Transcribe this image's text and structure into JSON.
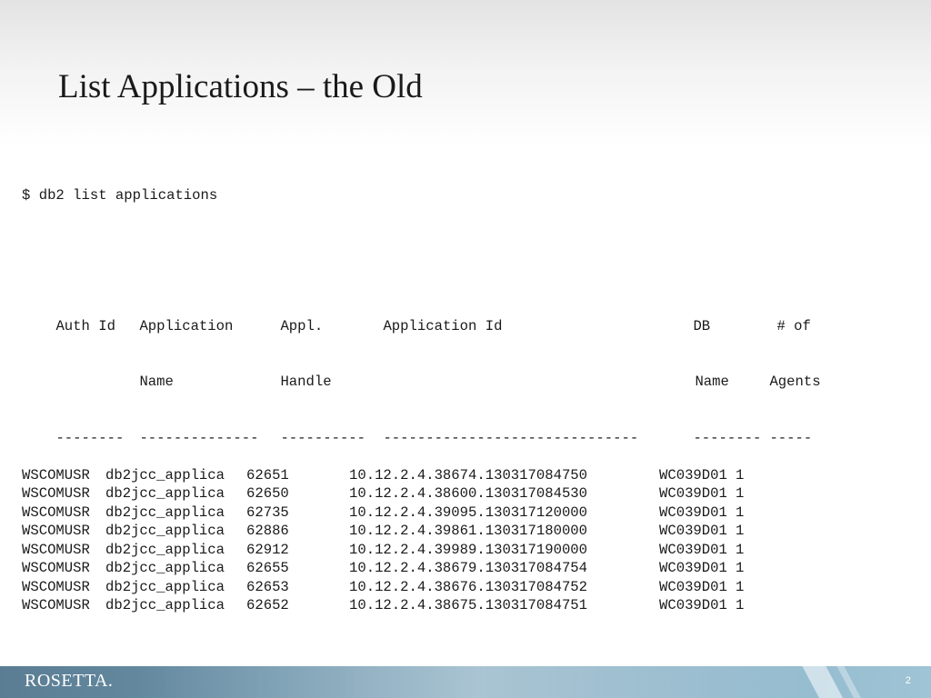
{
  "slide": {
    "title": "List Applications – the Old",
    "page_number": "2",
    "logo_text": "ROSETTA."
  },
  "terminal": {
    "command": "$ db2 list applications",
    "header_row1": [
      "Auth Id",
      "Application",
      "Appl.",
      "Application Id",
      "DB",
      "# of"
    ],
    "header_row2": [
      "",
      "Name",
      "Handle",
      "",
      "Name",
      "Agents"
    ],
    "separator": [
      "--------",
      "--------------",
      "----------",
      "------------------------------",
      "--------",
      "-----"
    ],
    "rows": [
      [
        "WSCOMUSR",
        "db2jcc_applica",
        "62651",
        "10.12.2.4.38674.130317084750",
        "WC039D01",
        "1"
      ],
      [
        "WSCOMUSR",
        "db2jcc_applica",
        "62650",
        "10.12.2.4.38600.130317084530",
        "WC039D01",
        "1"
      ],
      [
        "WSCOMUSR",
        "db2jcc_applica",
        "62735",
        "10.12.2.4.39095.130317120000",
        "WC039D01",
        "1"
      ],
      [
        "WSCOMUSR",
        "db2jcc_applica",
        "62886",
        "10.12.2.4.39861.130317180000",
        "WC039D01",
        "1"
      ],
      [
        "WSCOMUSR",
        "db2jcc_applica",
        "62912",
        "10.12.2.4.39989.130317190000",
        "WC039D01",
        "1"
      ],
      [
        "WSCOMUSR",
        "db2jcc_applica",
        "62655",
        "10.12.2.4.38679.130317084754",
        "WC039D01",
        "1"
      ],
      [
        "WSCOMUSR",
        "db2jcc_applica",
        "62653",
        "10.12.2.4.38676.130317084752",
        "WC039D01",
        "1"
      ],
      [
        "WSCOMUSR",
        "db2jcc_applica",
        "62652",
        "10.12.2.4.38675.130317084751",
        "WC039D01",
        "1"
      ]
    ]
  }
}
